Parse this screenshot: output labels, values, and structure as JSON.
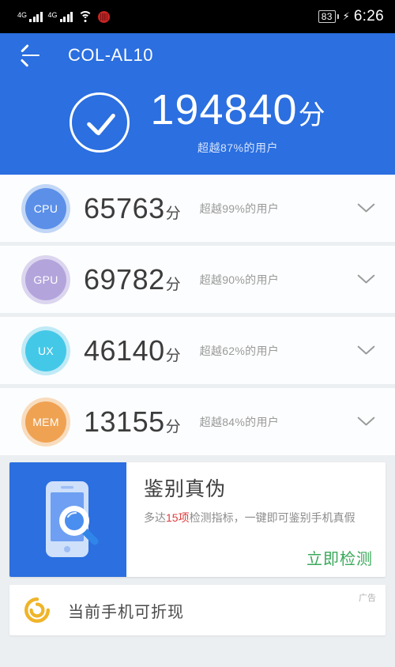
{
  "statusbar": {
    "network_left": "4G",
    "network_right": "4G",
    "wifi_icon": "wifi-icon",
    "alert_icon": "virus-alert-icon",
    "battery_level": "83",
    "charging_icon": "charging-bolt-icon",
    "time": "6:26"
  },
  "appbar": {
    "back_icon": "back-arrow-icon",
    "title": "COL-AL10"
  },
  "hero": {
    "check_icon": "check-circle-icon",
    "total_score": "194840",
    "unit": "分",
    "percentile": "超越87%的用户",
    "bg_color": "#2b6fe0"
  },
  "metrics": [
    {
      "key": "cpu",
      "label": "CPU",
      "score": "65763",
      "unit": "分",
      "percentile": "超越99%的用户",
      "color": "#5b8fe8",
      "ring": "#c2d7f6",
      "chevron_icon": "chevron-down-icon"
    },
    {
      "key": "gpu",
      "label": "GPU",
      "score": "69782",
      "unit": "分",
      "percentile": "超越90%的用户",
      "color": "#b3a4dc",
      "ring": "#dcd5ef",
      "chevron_icon": "chevron-down-icon"
    },
    {
      "key": "ux",
      "label": "UX",
      "score": "46140",
      "unit": "分",
      "percentile": "超越62%的用户",
      "color": "#44c8e8",
      "ring": "#bfeaf6",
      "chevron_icon": "chevron-down-icon"
    },
    {
      "key": "mem",
      "label": "MEM",
      "score": "13155",
      "unit": "分",
      "percentile": "超越84%的用户",
      "color": "#efa252",
      "ring": "#f8dcbd",
      "chevron_icon": "chevron-down-icon"
    }
  ],
  "promo": {
    "art_icon": "phone-magnifier-icon",
    "title": "鉴别真伪",
    "desc_before": "多达",
    "desc_highlight": "15项",
    "desc_after": "检测指标，一键即可鉴别手机真假",
    "highlight_color": "#e03b3b",
    "cta": "立即检测",
    "cta_color": "#3aa85a"
  },
  "ad": {
    "logo_icon": "spiral-logo-icon",
    "logo_color": "#f0b429",
    "text": "当前手机可折现",
    "tag": "广告"
  }
}
